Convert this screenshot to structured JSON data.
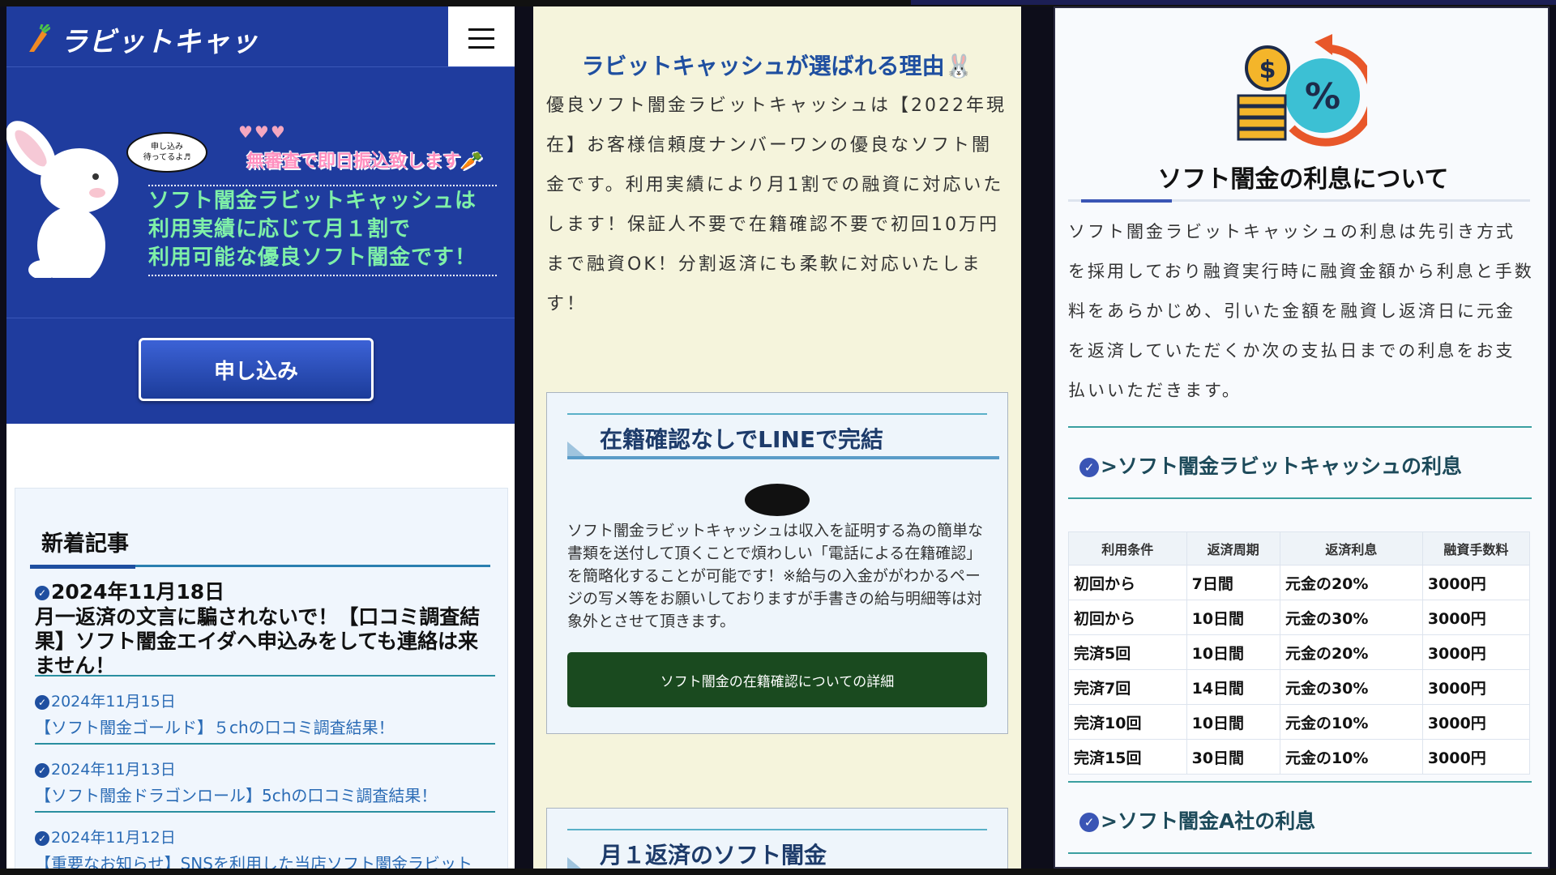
{
  "panel1": {
    "logo": "ラビットキャッシュ",
    "banner": {
      "bubble": "申し込み\n待ってるよ♬",
      "hearts": "♥♥♥",
      "sub": "無審査で即日振込致します🥕",
      "main_lines": [
        "ソフト闇金ラビットキャッシュは",
        "利用実績に応じて月１割で",
        "利用可能な優良ソフト闇金です！"
      ]
    },
    "apply_button": "申し込み",
    "news": {
      "title": "新着記事",
      "items": [
        {
          "date": "2024年11月18日",
          "title": "月一返済の文言に騙されないで！【口コミ調査結果】ソフト闇金エイダへ申込みをしても連絡は来ません！"
        },
        {
          "date": "2024年11月15日",
          "title": "【ソフト闇金ゴールド】５chの口コミ調査結果！"
        },
        {
          "date": "2024年11月13日",
          "title": "【ソフト闇金ドラゴンロール】5chの口コミ調査結果！"
        },
        {
          "date": "2024年11月12日",
          "title": "【重要なお知らせ】SNSを利用した当店ソフト闇金ラビット"
        }
      ]
    }
  },
  "panel2": {
    "title": "ラビットキャッシュが選ばれる理由🐰",
    "intro": "優良ソフト闇金ラビットキャッシュは【2022年現在】お客様信頼度ナンバーワンの優良なソフト闇金です。利用実績により月1割での融資に対応いたします！保証人不要で在籍確認不要で初回10万円まで融資OK！分割返済にも柔軟に対応いたします！",
    "card1": {
      "heading": "在籍確認なしでLINEで完結",
      "text": "ソフト闇金ラビットキャッシュは収入を証明する為の簡単な書類を送付して頂くことで煩わしい「電話による在籍確認」を簡略化することが可能です！※給与の入金ががわかるページの写メ等をお願いしておりますが手書きの給与明細等は対象外とさせて頂きます。",
      "button": "ソフト闇金の在籍確認についての詳細"
    },
    "card2": {
      "heading": "月１返済のソフト闇金"
    }
  },
  "panel3": {
    "title": "ソフト闇金の利息について",
    "text": "ソフト闇金ラビットキャッシュの利息は先引き方式を採用しており融資実行時に融資金額から利息と手数料をあらかじめ、引いた金額を融資し返済日に元金を返済していただくか次の支払日までの利息をお支払いいただきます。",
    "sub1": ">ソフト闇金ラビットキャッシュの利息",
    "table": {
      "headers": [
        "利用条件",
        "返済周期",
        "返済利息",
        "融資手数料"
      ],
      "rows": [
        [
          "初回から",
          "7日間",
          "元金の20%",
          "3000円"
        ],
        [
          "初回から",
          "10日間",
          "元金の30%",
          "3000円"
        ],
        [
          "完済5回",
          "10日間",
          "元金の20%",
          "3000円"
        ],
        [
          "完済7回",
          "14日間",
          "元金の30%",
          "3000円"
        ],
        [
          "完済10回",
          "10日間",
          "元金の10%",
          "3000円"
        ],
        [
          "完済15回",
          "30日間",
          "元金の10%",
          "3000円"
        ]
      ]
    },
    "sub2": ">ソフト闇金A社の利息"
  }
}
